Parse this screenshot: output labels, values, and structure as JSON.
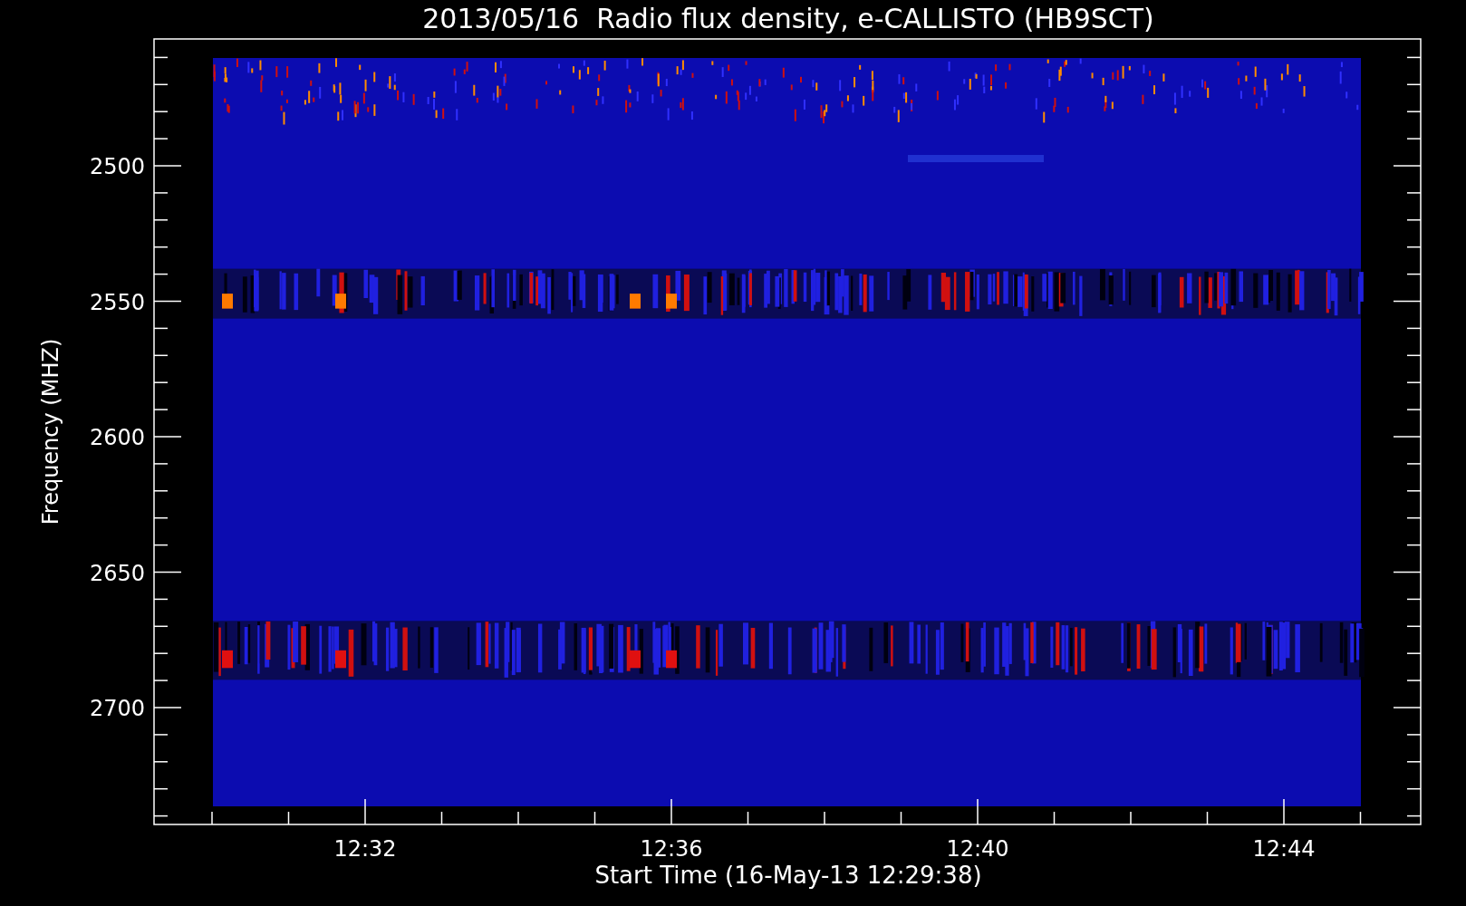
{
  "title": "2013/05/16  Radio flux density, e-CALLISTO (HB9SCT)",
  "ylabel": "Frequency (MHZ)",
  "xlabel": "Start Time (16-May-13 12:29:38)",
  "yticks": [
    {
      "label": "2500"
    },
    {
      "label": "2550"
    },
    {
      "label": "2600"
    },
    {
      "label": "2650"
    },
    {
      "label": "2700"
    }
  ],
  "xticks": [
    {
      "label": "12:32"
    },
    {
      "label": "12:36"
    },
    {
      "label": "12:40"
    },
    {
      "label": "12:44"
    }
  ]
}
